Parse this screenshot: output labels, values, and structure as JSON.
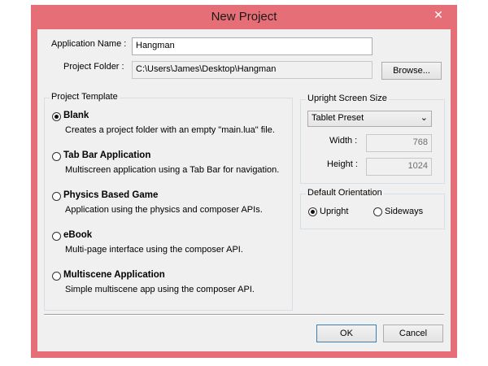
{
  "window": {
    "title": "New Project",
    "close_glyph": "✕"
  },
  "fields": {
    "app_name_label": "Application Name :",
    "app_name_value": "Hangman",
    "folder_label": "Project Folder :",
    "folder_value": "C:\\Users\\James\\Desktop\\Hangman",
    "browse_label": "Browse..."
  },
  "template_group": {
    "legend": "Project Template",
    "selected": 0,
    "items": [
      {
        "title": "Blank",
        "desc": "Creates a project folder with an empty \"main.lua\" file."
      },
      {
        "title": "Tab Bar Application",
        "desc": "Multiscreen application using a Tab Bar for navigation."
      },
      {
        "title": "Physics Based Game",
        "desc": "Application using the physics and composer APIs."
      },
      {
        "title": "eBook",
        "desc": "Multi-page interface using the composer API."
      },
      {
        "title": "Multiscene Application",
        "desc": "Simple multiscene app using the composer API."
      }
    ]
  },
  "screen_size_group": {
    "legend": "Upright Screen Size",
    "preset_value": "Tablet Preset",
    "width_label": "Width :",
    "width_value": "768",
    "height_label": "Height :",
    "height_value": "1024"
  },
  "orientation_group": {
    "legend": "Default Orientation",
    "selected": "upright",
    "upright_label": "Upright",
    "sideways_label": "Sideways"
  },
  "footer": {
    "ok_label": "OK",
    "cancel_label": "Cancel"
  }
}
